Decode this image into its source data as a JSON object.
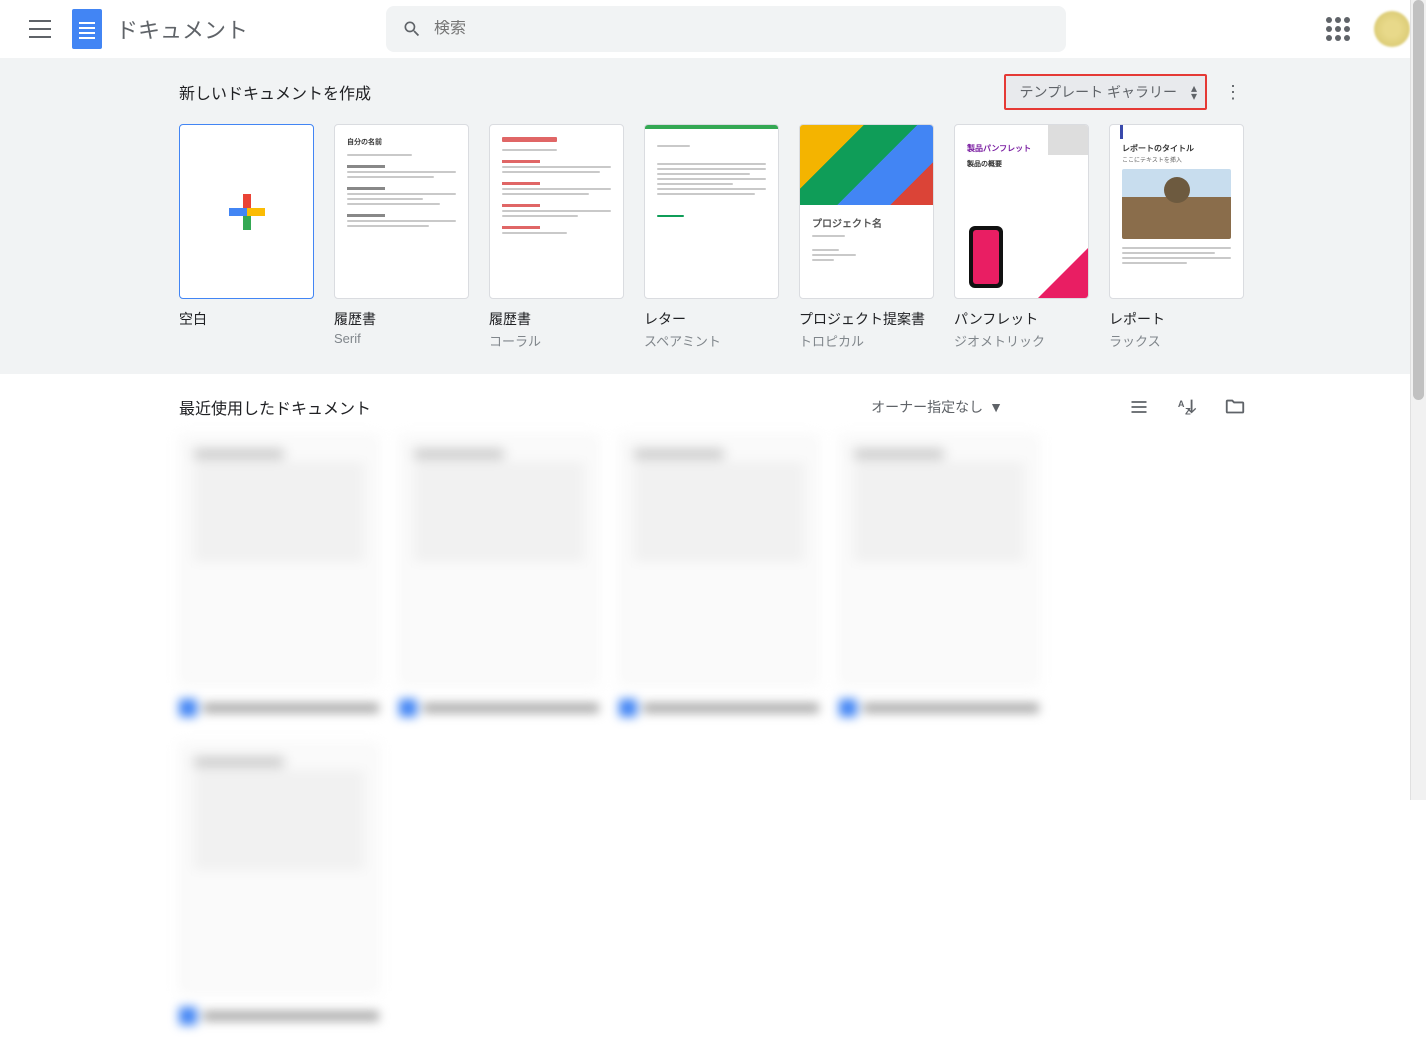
{
  "header": {
    "app_title": "ドキュメント",
    "search_placeholder": "検索"
  },
  "templates": {
    "heading": "新しいドキュメントを作成",
    "gallery_button": "テンプレート ギャラリー",
    "items": [
      {
        "title": "空白",
        "subtitle": ""
      },
      {
        "title": "履歴書",
        "subtitle": "Serif"
      },
      {
        "title": "履歴書",
        "subtitle": "コーラル"
      },
      {
        "title": "レター",
        "subtitle": "スペアミント"
      },
      {
        "title": "プロジェクト提案書",
        "subtitle": "トロピカル"
      },
      {
        "title": "パンフレット",
        "subtitle": "ジオメトリック"
      },
      {
        "title": "レポート",
        "subtitle": "ラックス"
      }
    ],
    "thumb_text": {
      "resume_name": "自分の名前",
      "project_name": "プロジェクト名",
      "brochure_title": "製品パンフレット",
      "brochure_sub": "製品の概要",
      "report_title": "レポートのタイトル",
      "report_sub": "ここにテキストを挿入"
    }
  },
  "recent": {
    "heading": "最近使用したドキュメント",
    "owner_filter": "オーナー指定なし"
  }
}
